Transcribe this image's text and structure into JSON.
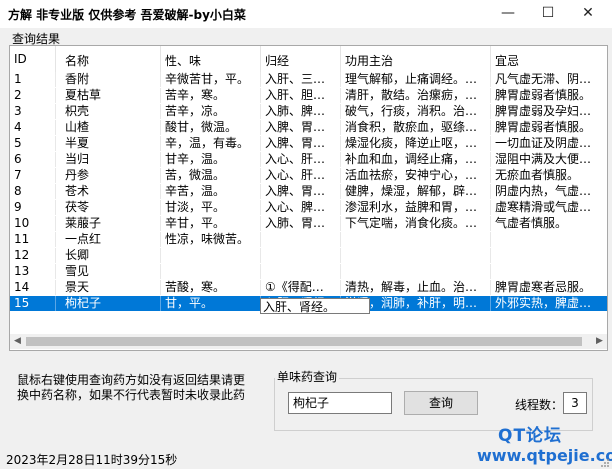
{
  "window": {
    "title": "方解 非专业版  仅供参考 吾爱破解-by小白菜",
    "min_glyph": "—",
    "max_glyph": "☐",
    "close_glyph": "✕"
  },
  "results": {
    "group_label": "查询结果",
    "columns": [
      "ID",
      "名称",
      "性、味",
      "归经",
      "功用主治",
      "宜忌"
    ],
    "rows": [
      [
        "1",
        "香附",
        "辛微苦甘，平。",
        "入肝、三…",
        "理气解郁，止痛调经。…",
        "凡气虚无滞、阴…"
      ],
      [
        "2",
        "夏枯草",
        "苦辛，寒。",
        "入肝、胆…",
        "清肝，散结。治瘰疬，…",
        "脾胃虚弱者慎服。"
      ],
      [
        "3",
        "枳壳",
        "苦辛，凉。",
        "入肺、脾…",
        "破气，行痰，消积。治…",
        "脾胃虚弱及孕妇…"
      ],
      [
        "4",
        "山楂",
        "酸甘，微温。",
        "入脾、胃…",
        "消食积，散瘀血，驱绦…",
        "脾胃虚弱者慎服。"
      ],
      [
        "5",
        "半夏",
        "辛，温，有毒。",
        "入脾、胃…",
        "燥湿化痰，降逆止呕，…",
        "一切血证及阴虚…"
      ],
      [
        "6",
        "当归",
        "甘辛，温。",
        "入心、肝…",
        "补血和血，调经止痛，…",
        "湿阻中满及大便…"
      ],
      [
        "7",
        "丹参",
        "苦，微温。",
        "入心、肝…",
        "活血祛瘀，安神宁心，…",
        "无瘀血者慎服。"
      ],
      [
        "8",
        "苍术",
        "辛苦，温。",
        "入脾、胃…",
        "健脾，燥湿，解郁，辟…",
        "阴虚内热，气虚…"
      ],
      [
        "9",
        "茯苓",
        "甘淡，平。",
        "入心、脾…",
        "渗湿利水，益脾和胃，…",
        "虚寒精滑或气虚…"
      ],
      [
        "10",
        "莱菔子",
        "辛甘，平。",
        "入肺、胃…",
        "下气定喘，消食化痰。…",
        "气虚者慎服。"
      ],
      [
        "11",
        "一点红",
        "性凉，味微苦。",
        "",
        "",
        ""
      ],
      [
        "12",
        "长卿",
        "",
        "",
        "",
        ""
      ],
      [
        "13",
        "雪见",
        "",
        "",
        "",
        ""
      ],
      [
        "14",
        "景天",
        "苦酸，寒。",
        "①《得配…",
        "清热，解毒，止血。治…",
        "脾胃虚寒者忌服。"
      ],
      [
        "15",
        "枸杞子",
        "甘，平。",
        "入肝、肾经。",
        "滋肾，润肺，补肝，明…",
        "外邪实热，脾虚…"
      ]
    ],
    "editing_cell_value": "入肝、肾经。"
  },
  "hint": "鼠标右键使用查询药方如没有返回结果请更换中药名称，如果不行代表暂时未收录此药",
  "single_query": {
    "label": "单味药查询",
    "input_value": "枸杞子",
    "button_label": "查询",
    "thread_label": "线程数：",
    "thread_value": "3"
  },
  "status": {
    "text": "2023年2月28日11时39分15秒"
  },
  "watermark": {
    "line1": "QT论坛",
    "line2": "www.qtpejie.com"
  }
}
